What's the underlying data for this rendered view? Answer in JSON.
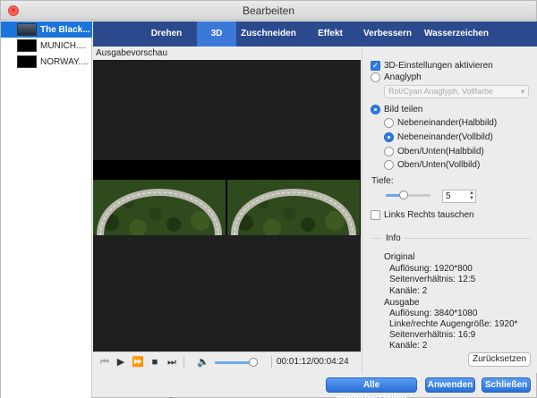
{
  "window": {
    "title": "Bearbeiten"
  },
  "files": [
    {
      "name": "The Black..."
    },
    {
      "name": "MUNICH...."
    },
    {
      "name": "NORWAY...."
    }
  ],
  "tabs": [
    "Drehen",
    "3D",
    "Zuschneiden",
    "Effekt",
    "Verbessern",
    "Wasserzeichen"
  ],
  "active_tab": "3D",
  "preview": {
    "label": "Ausgabevorschau",
    "time": "00:01:12/00:04:24",
    "progress": 0.27,
    "volume": 0.9
  },
  "settings": {
    "enable_3d": "3D-Einstellungen aktivieren",
    "anaglyph": "Anaglyph",
    "anaglyph_select": "Rot/Cyan Anaglyph, Vollfarbe",
    "split": "Bild teilen",
    "split_options": [
      "Nebeneinander(Halbbild)",
      "Nebeneinander(Vollbild)",
      "Oben/Unten(Halbbild)",
      "Oben/Unten(Vollbild)"
    ],
    "depth_label": "Tiefe:",
    "depth_value": "5",
    "depth_level": 0.4,
    "swap": "Links Rechts tauschen"
  },
  "info": {
    "title": "Info",
    "original_heading": "Original",
    "original": [
      "Auflösung: 1920*800",
      "Seitenverhältnis: 12:5",
      "Kanäle: 2"
    ],
    "output_heading": "Ausgabe",
    "output": [
      "Auflösung: 3840*1080",
      "Linke/rechte Augengröße: 1920*",
      "Seitenverhältnis: 16:9",
      "Kanäle: 2"
    ],
    "reset": "Zurücksetzen"
  },
  "buttons": {
    "restore_all": "Alle wiederherstellen",
    "apply": "Anwenden",
    "close": "Schließen"
  },
  "colors": {
    "tabbar": "#2b4a8e",
    "active_tab": "#3c78d8",
    "accent": "#2f7de1"
  }
}
